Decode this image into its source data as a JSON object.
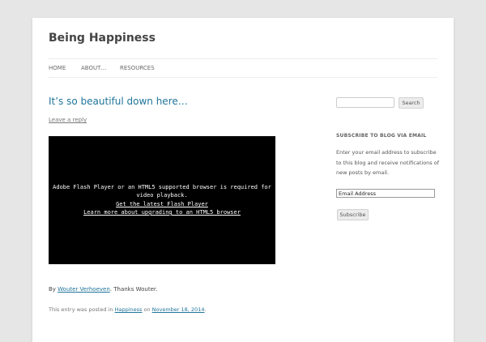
{
  "site": {
    "title": "Being Happiness"
  },
  "nav": {
    "items": [
      "HOME",
      "ABOUT…",
      "RESOURCES"
    ]
  },
  "post": {
    "title": "It’s so beautiful down here…",
    "leave_reply": "Leave a reply",
    "video": {
      "message": "Adobe Flash Player or an HTML5 supported browser is required for video playback.",
      "link1": "Get the latest Flash Player",
      "link2": "Learn more about upgrading to an HTML5 browser"
    },
    "credit": {
      "prefix": "By ",
      "author": "Wouter Verhoeven",
      "suffix": ". Thanks Wouter."
    },
    "meta": {
      "prefix": "This entry was posted in ",
      "category": "Happiness",
      "middle": " on ",
      "date": "November 18, 2014",
      "suffix": "."
    }
  },
  "sidebar": {
    "search": {
      "value": "",
      "button": "Search"
    },
    "subscribe": {
      "title": "SUBSCRIBE TO BLOG VIA EMAIL",
      "text": "Enter your email address to subscribe to this blog and receive notifications of new posts by email.",
      "email_value": "Email Address",
      "button": "Subscribe"
    }
  },
  "colors": {
    "link": "#21759b",
    "background": "#e6e6e6",
    "page": "#ffffff",
    "video": "#000000"
  }
}
